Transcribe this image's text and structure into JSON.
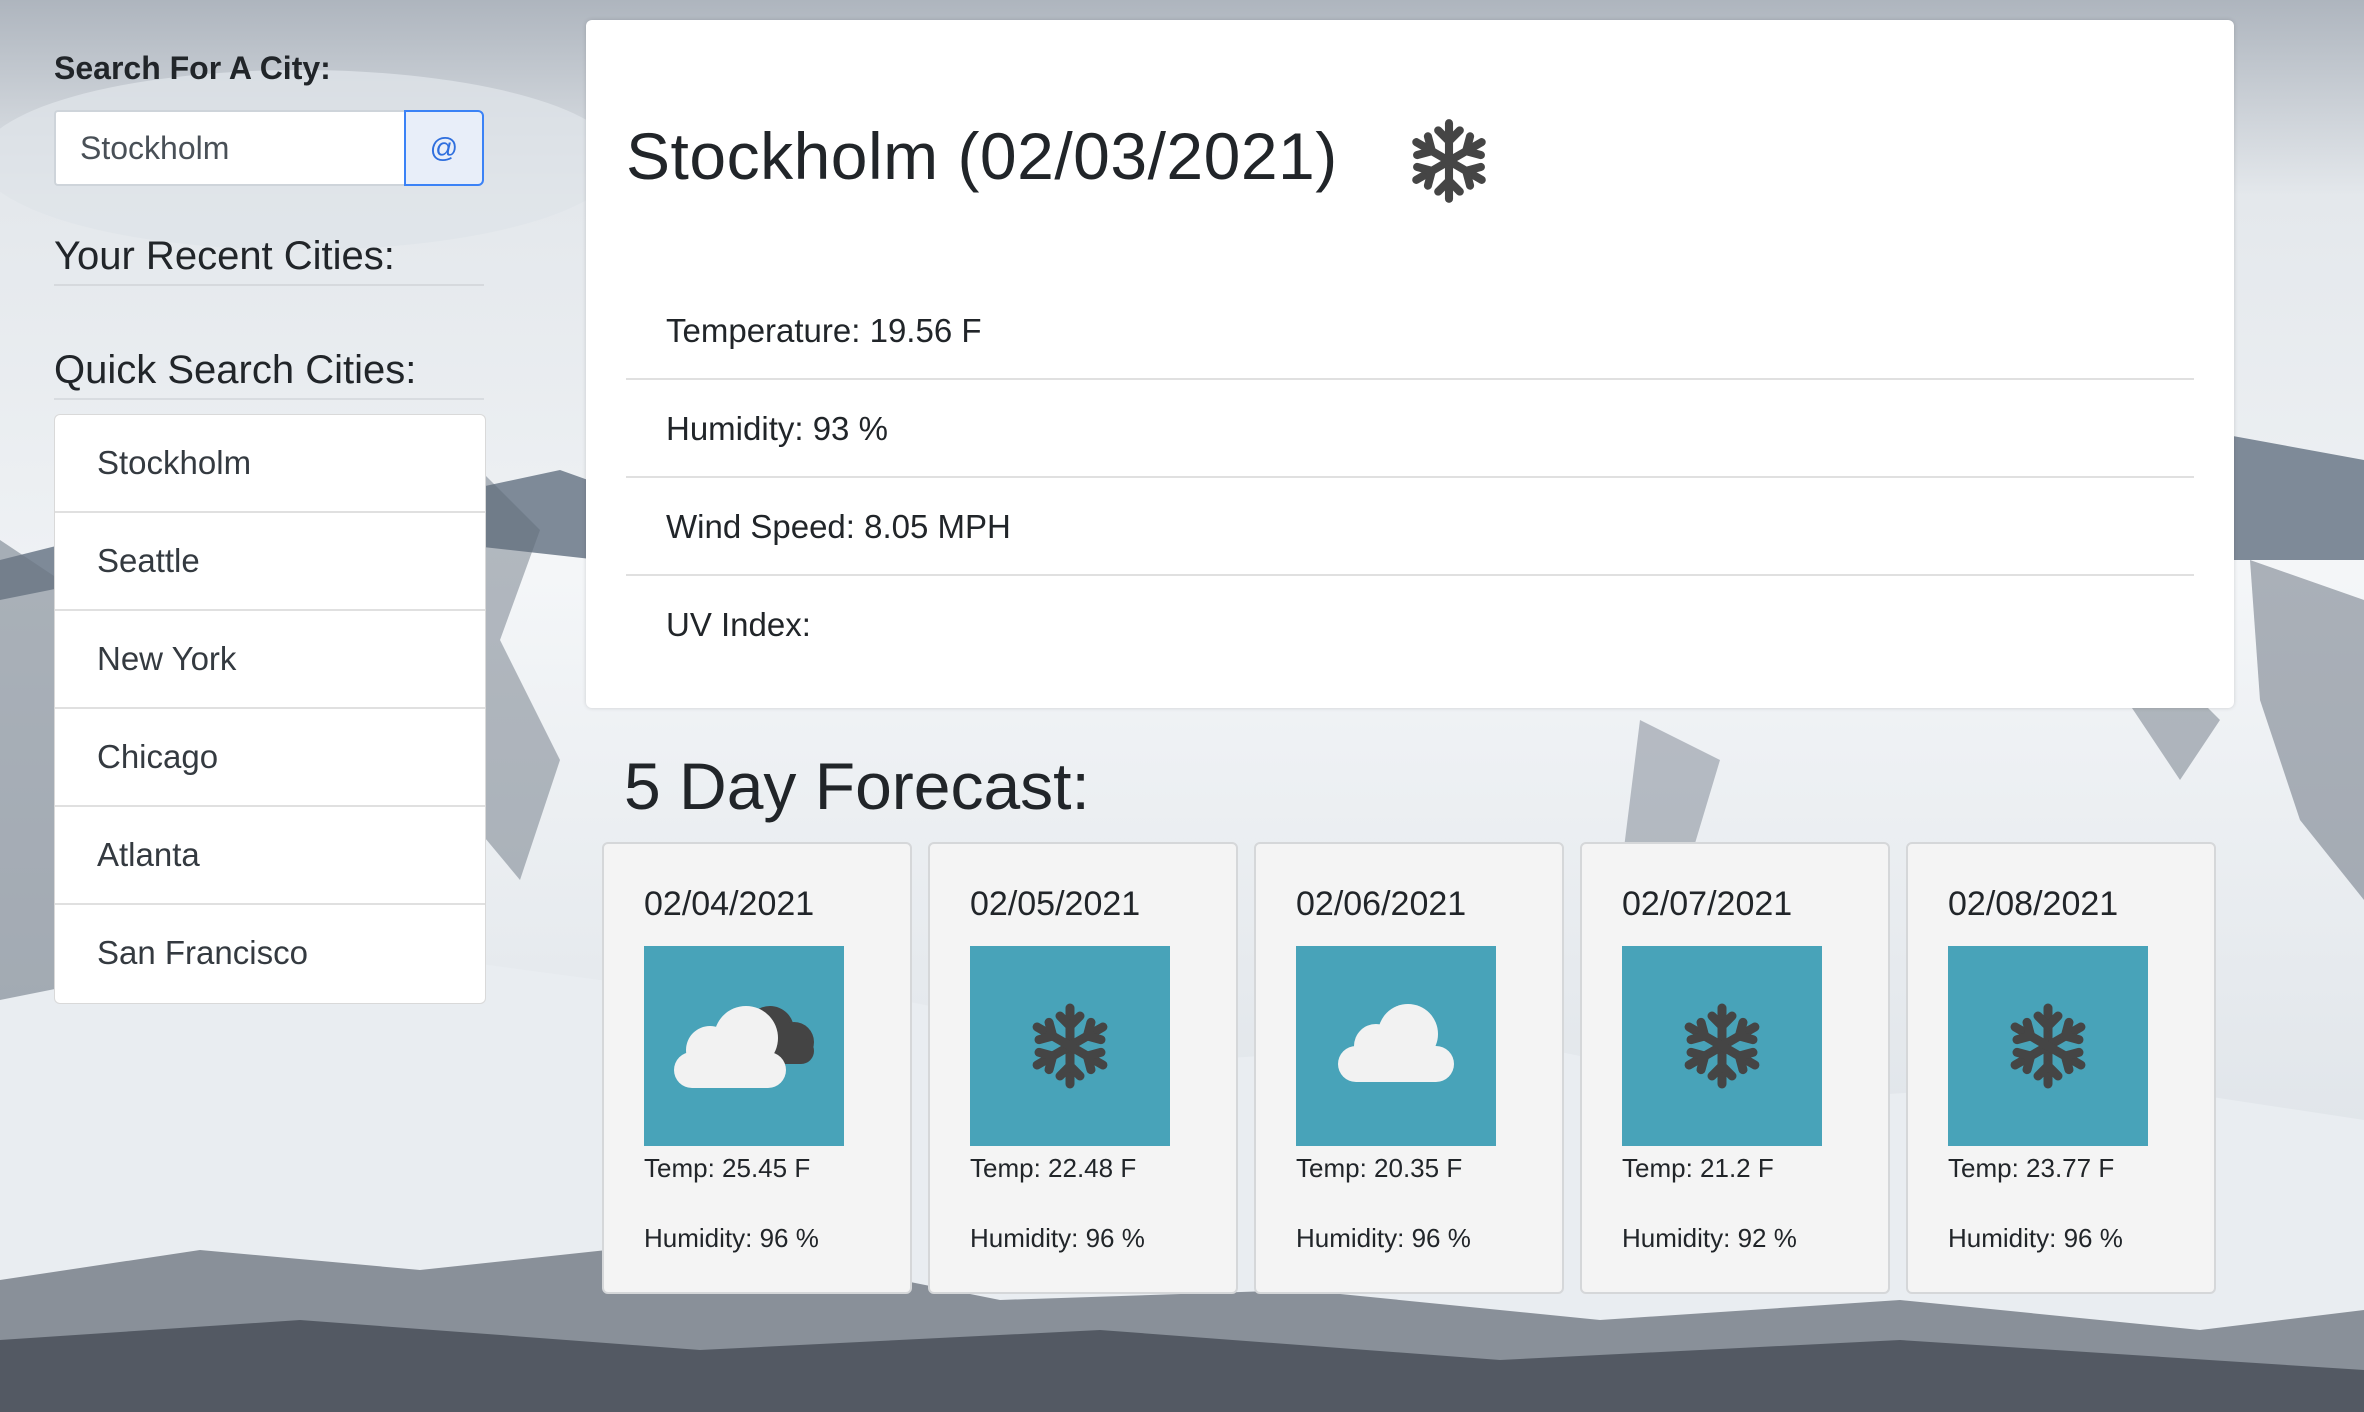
{
  "sidebar": {
    "search_label": "Search For A City:",
    "search_value": "Stockholm",
    "search_button": "@",
    "recent_title": "Your Recent Cities:",
    "quick_title": "Quick Search Cities:",
    "cities": [
      "Stockholm",
      "Seattle",
      "New York",
      "Chicago",
      "Atlanta",
      "San Francisco"
    ]
  },
  "current": {
    "title": "Stockholm (02/03/2021)",
    "icon": "snowflake-icon",
    "temperature": "Temperature: 19.56 F",
    "humidity": "Humidity: 93 %",
    "wind": "Wind Speed: 8.05 MPH",
    "uv": "UV Index:"
  },
  "forecast": {
    "title": "5 Day Forecast:",
    "days": [
      {
        "date": "02/04/2021",
        "icon": "dark-cloud-icon",
        "temp": "Temp: 25.45 F",
        "humidity": "Humidity: 96 %"
      },
      {
        "date": "02/05/2021",
        "icon": "snowflake-icon",
        "temp": "Temp: 22.48 F",
        "humidity": "Humidity: 96 %"
      },
      {
        "date": "02/06/2021",
        "icon": "cloud-icon",
        "temp": "Temp: 20.35 F",
        "humidity": "Humidity: 96 %"
      },
      {
        "date": "02/07/2021",
        "icon": "snowflake-icon",
        "temp": "Temp: 21.2 F",
        "humidity": "Humidity: 92 %"
      },
      {
        "date": "02/08/2021",
        "icon": "snowflake-icon",
        "temp": "Temp: 23.77 F",
        "humidity": "Humidity: 96 %"
      }
    ]
  },
  "colors": {
    "tile": "#48a3b9",
    "icon_dark": "#454545",
    "accent": "#3b82f6"
  }
}
